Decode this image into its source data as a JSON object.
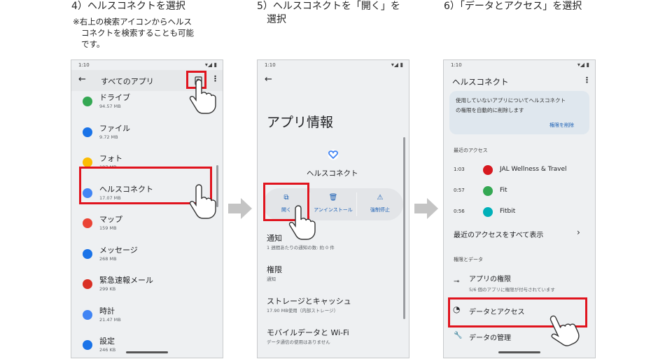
{
  "captions": {
    "step4": "4）ヘルスコネクトを選択",
    "step4_note_l1": "※右上の検索アイコンからヘルス",
    "step4_note_l2": "コネクトを検索することも可能",
    "step4_note_l3": "です。",
    "step5_l1": "5）ヘルスコネクトを「開く」を",
    "step5_l2": "選択",
    "step6": "6）「データとアクセス」を選択"
  },
  "status_time": "1:10",
  "status_icons": "▾◢ ▮",
  "phone1": {
    "title": "すべてのアプリ",
    "apps": [
      {
        "name": "ドライブ",
        "size": "94.57 MB",
        "icon": "drive-icon",
        "color": "#34a853"
      },
      {
        "name": "ファイル",
        "size": "9.72 MB",
        "icon": "files-icon",
        "color": "#1a73e8"
      },
      {
        "name": "フォト",
        "size": "197 MB",
        "icon": "photos-icon",
        "color": "#fbbc04"
      },
      {
        "name": "ヘルスコネクト",
        "size": "17.07 MB",
        "icon": "health-connect-icon",
        "color": "#4285f4"
      },
      {
        "name": "マップ",
        "size": "159 MB",
        "icon": "maps-icon",
        "color": "#ea4335"
      },
      {
        "name": "メッセージ",
        "size": "268 MB",
        "icon": "messages-icon",
        "color": "#1a73e8"
      },
      {
        "name": "緊急速報メール",
        "size": "299 KB",
        "icon": "alert-icon",
        "color": "#d93025"
      },
      {
        "name": "時計",
        "size": "21.47 MB",
        "icon": "clock-icon",
        "color": "#4285f4"
      },
      {
        "name": "設定",
        "size": "246 KB",
        "icon": "settings-icon",
        "color": "#1a73e8"
      }
    ]
  },
  "phone2": {
    "title": "アプリ情報",
    "app_name": "ヘルスコネクト",
    "actions": [
      {
        "label": "開く",
        "icon": "open-icon"
      },
      {
        "label": "アンインストール",
        "icon": "trash-icon"
      },
      {
        "label": "強制停止",
        "icon": "warning-icon"
      }
    ],
    "rows": [
      {
        "title": "通知",
        "sub": "1 週間あたりの通知の数: 約 0 件"
      },
      {
        "title": "権限",
        "sub": "通知"
      },
      {
        "title": "ストレージとキャッシュ",
        "sub": "17.90 MB使用（内部ストレージ）"
      },
      {
        "title": "モバイルデータと Wi-Fi",
        "sub": "データ通信の使用はありません"
      }
    ]
  },
  "phone3": {
    "title": "ヘルスコネクト",
    "card_text_l1": "使用していないアプリについてヘルスコネクト",
    "card_text_l2": "の権限を自動的に削除します",
    "card_link": "権限を削除",
    "recent_header": "最近のアクセス",
    "recent": [
      {
        "time": "1:03",
        "app": "JAL Wellness & Travel",
        "icon": "jal-icon",
        "color": "#d71920"
      },
      {
        "time": "0:57",
        "app": "Fit",
        "icon": "fit-icon",
        "color": "#34a853"
      },
      {
        "time": "0:56",
        "app": "Fitbit",
        "icon": "fitbit-icon",
        "color": "#00b0b9"
      }
    ],
    "see_all": "最近のアクセスをすべて表示",
    "perm_header": "権限とデータ",
    "app_perms_title": "アプリの権限",
    "app_perms_sub": "5/6 個のアプリに権限が付与されています",
    "data_access": "データとアクセス",
    "manage_data": "データの管理"
  }
}
